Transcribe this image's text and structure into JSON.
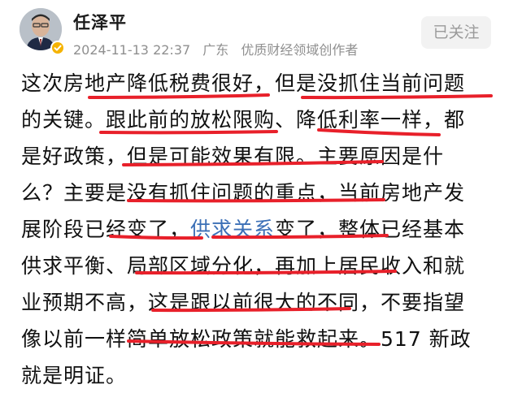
{
  "author": {
    "name": "任泽平",
    "date": "2024-11-13 22:37",
    "location": "广东",
    "title": "优质财经领域创作者",
    "avatar": "avatar-photo",
    "verified_icon": "verified-badge-icon"
  },
  "follow_button": {
    "label": "已关注"
  },
  "post": {
    "lines": [
      [
        {
          "text": "这次房地产降低税费很好，但是没抓住当前问题"
        }
      ],
      [
        {
          "text": "的关键。跟此前的放松限购、降低利率一样，都"
        }
      ],
      [
        {
          "text": "是好政策，但是可能效果有限。主要原因是什"
        }
      ],
      [
        {
          "text": "么？主要是没有抓住问题的重点，当前房地产发"
        }
      ],
      [
        {
          "text": "展阶段已经变了，"
        },
        {
          "text": "供求关系",
          "link": true
        },
        {
          "text": "变了，整体已经基本"
        }
      ],
      [
        {
          "text": "供求平衡、局部区域分化，再加上居民收入和就"
        }
      ],
      [
        {
          "text": "业预期不高，这是跟以前很大的不同，不要指望"
        }
      ],
      [
        {
          "text": "像以前一样简单放松政策就能救起来。517 新政"
        }
      ],
      [
        {
          "text": "就是明证。"
        }
      ]
    ]
  },
  "colors": {
    "underline": "#e8202a",
    "link": "#3b6fb6",
    "meta": "#8f8f8f",
    "verified": "#f5b301"
  }
}
